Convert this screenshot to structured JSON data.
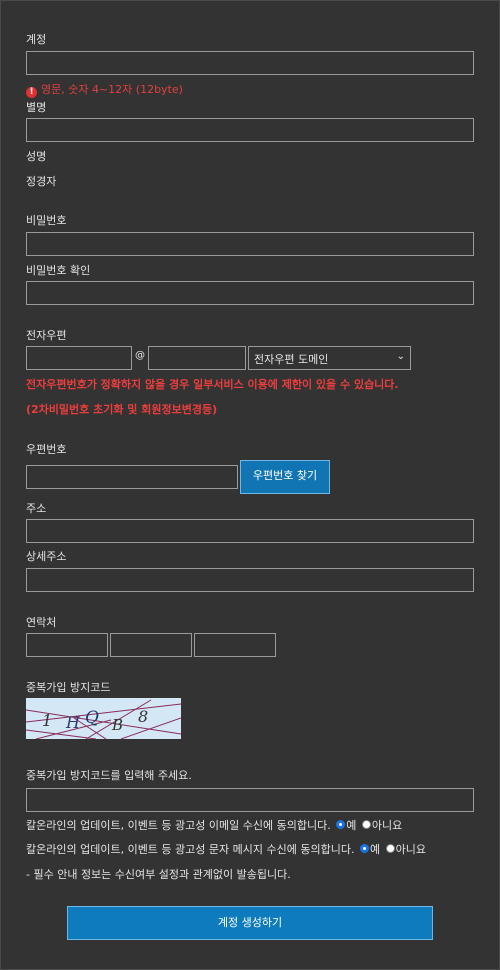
{
  "account": {
    "label": "계정",
    "hint": "영문, 숫자 4~12자 (12byte)"
  },
  "nickname": {
    "label": "별명"
  },
  "name": {
    "label": "성명",
    "value": "정경자"
  },
  "password": {
    "label": "비밀번호"
  },
  "password_confirm": {
    "label": "비밀번호 확인"
  },
  "email": {
    "label": "전자우편",
    "at": "@",
    "domain_select": "전자우편 도메인",
    "warning_line1": "전자우편번호가 정확하지 않을 경우 일부서비스 이용에 제한이 있을 수 있습니다.",
    "warning_line2": "(2차비밀번호 초기화 및 회원정보변경등)"
  },
  "postcode": {
    "label": "우편번호",
    "find_button": "우편번호 찾기"
  },
  "address": {
    "label": "주소"
  },
  "address_detail": {
    "label": "상세주소"
  },
  "contact": {
    "label": "연락처"
  },
  "captcha": {
    "label": "중복가입 방지코드",
    "image_text": [
      "1",
      "H",
      "Q",
      "B",
      "8"
    ],
    "input_label": "중복가입 방지코드를 입력해 주세요."
  },
  "consent_email": {
    "text": "칼온라인의 업데이트, 이벤트 등 광고성 이메일 수신에 동의합니다.",
    "yes": "예",
    "no": "아니요",
    "selected": "yes"
  },
  "consent_sms": {
    "text": "칼온라인의 업데이트, 이벤트 등 광고성 문자 메시지 수신에 동의합니다.",
    "yes": "예",
    "no": "아니요",
    "selected": "yes"
  },
  "notice": "- 필수 안내 정보는 수신여부 설정과 관계없이 발송됩니다.",
  "submit": "계정 생성하기",
  "colors": {
    "background": "#333333",
    "accent": "#0d7bbd",
    "error": "#e04040",
    "input_border": "#9a9a9a"
  }
}
